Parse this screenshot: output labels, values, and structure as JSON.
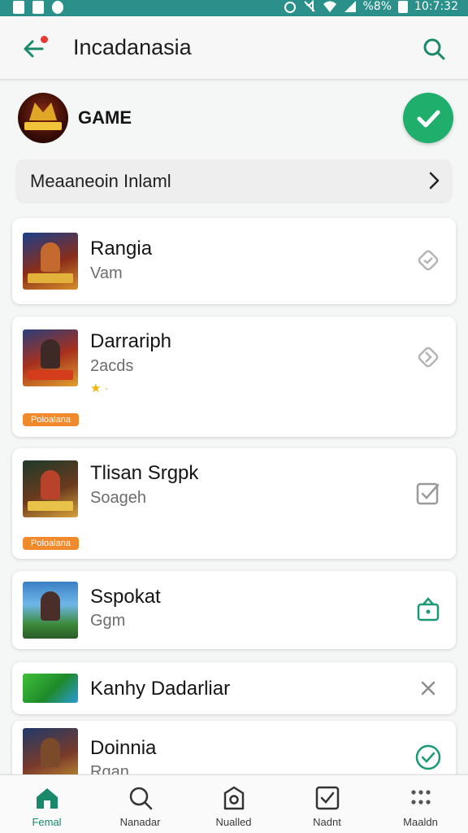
{
  "status_bar": {
    "battery": "%8%",
    "time": "10:7:32"
  },
  "app_bar": {
    "title": "Incadanasia"
  },
  "game_header": {
    "name": "GAME"
  },
  "section_button": {
    "label": "Meaaneoin Inlaml"
  },
  "cards": [
    {
      "title": "Rangia",
      "subtitle": "Vam",
      "icon": "diamond-outline-icon",
      "icon_color": "#b5b5b5"
    },
    {
      "title": "Darrariph",
      "subtitle": "2acds",
      "stars": "★ ·",
      "badge": "Poloalana",
      "icon": "diamond-outline-icon",
      "icon_color": "#b5b5b5"
    },
    {
      "title": "Tlisan Srgpk",
      "subtitle": "Soageh",
      "badge": "Poloalana",
      "icon": "checkbox-icon",
      "icon_color": "#9a9a9a"
    },
    {
      "title": "Sspokat",
      "subtitle": "Ggm",
      "icon": "lock-bag-icon",
      "icon_color": "#1a9a74"
    },
    {
      "title": "Kanhy Dadarliar",
      "icon": "close-icon",
      "icon_color": "#8c8c8c"
    },
    {
      "title": "Doinnia",
      "subtitle": "Rgan",
      "icon": "check-circle-icon",
      "icon_color": "#1a9a74"
    }
  ],
  "bottom_nav": [
    {
      "label": "Femal",
      "icon": "home-icon",
      "active": true
    },
    {
      "label": "Nanadar",
      "icon": "search-icon",
      "active": false
    },
    {
      "label": "Nualled",
      "icon": "bag-icon",
      "active": false
    },
    {
      "label": "Nadnt",
      "icon": "checkbox-icon",
      "active": false
    },
    {
      "label": "Maaldn",
      "icon": "grid-dots-icon",
      "active": false
    }
  ],
  "colors": {
    "accent": "#1fae6b",
    "status_bar": "#2b8f8a",
    "badge": "#f08a2c",
    "active_nav": "#188a6b"
  }
}
